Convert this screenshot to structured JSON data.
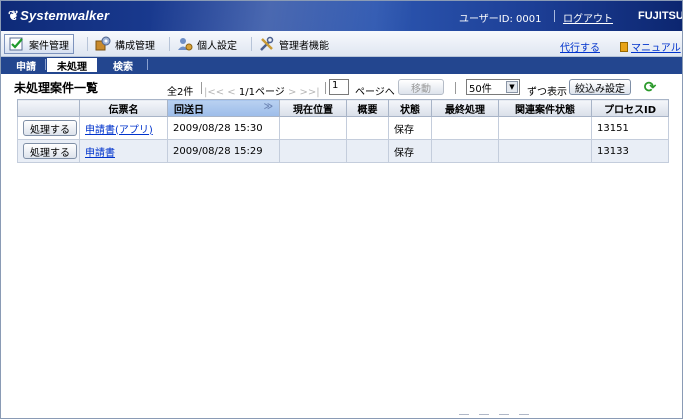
{
  "header": {
    "logo_text": "Systemwalker",
    "logo_mark": "❦",
    "user_id": "ユーザーID: 0001",
    "logout": "ログアウト",
    "brand": "FUJITSU"
  },
  "menu": {
    "items": [
      {
        "label": "案件管理",
        "icon": "checkbox-icon"
      },
      {
        "label": "構成管理",
        "icon": "gears-icon"
      },
      {
        "label": "個人設定",
        "icon": "person-settings-icon"
      },
      {
        "label": "管理者機能",
        "icon": "tools-icon"
      }
    ],
    "proxy": "代行する",
    "manual": "マニュアル"
  },
  "tabs": [
    {
      "label": "申請"
    },
    {
      "label": "未処理"
    },
    {
      "label": "検索"
    }
  ],
  "toolbar": {
    "title": "未処理案件一覧",
    "total": "全2件",
    "pager_prev": "|<< < ",
    "pager_current": "1/1ページ",
    "pager_next": " > >>|",
    "page_input": "1",
    "page_to": "ページへ",
    "move_button": "移動",
    "per_page": "50件",
    "per_page_suffix": "ずつ表示",
    "filter_button": "絞込み設定"
  },
  "table": {
    "headers": [
      "",
      "伝票名",
      "回送日",
      "現在位置",
      "概要",
      "状態",
      "最終処理",
      "関連案件状態",
      "プロセスID"
    ],
    "rows": [
      {
        "action": "処理する",
        "name": "申請書(アプリ)",
        "date": "2009/08/28 15:30",
        "location": "",
        "summary": "",
        "status": "保存",
        "last": "",
        "related": "",
        "pid": "13151"
      },
      {
        "action": "処理する",
        "name": "申請書",
        "date": "2009/08/28 15:29",
        "location": "",
        "summary": "",
        "status": "保存",
        "last": "",
        "related": "",
        "pid": "13133"
      }
    ]
  },
  "colors": {
    "header_bg": "#1d3f96",
    "tab_bg": "#23468f",
    "sorted_header": "#9cbce9",
    "link": "#0033cc",
    "alt_row": "#e9eef6",
    "refresh": "#2b9a2b"
  }
}
